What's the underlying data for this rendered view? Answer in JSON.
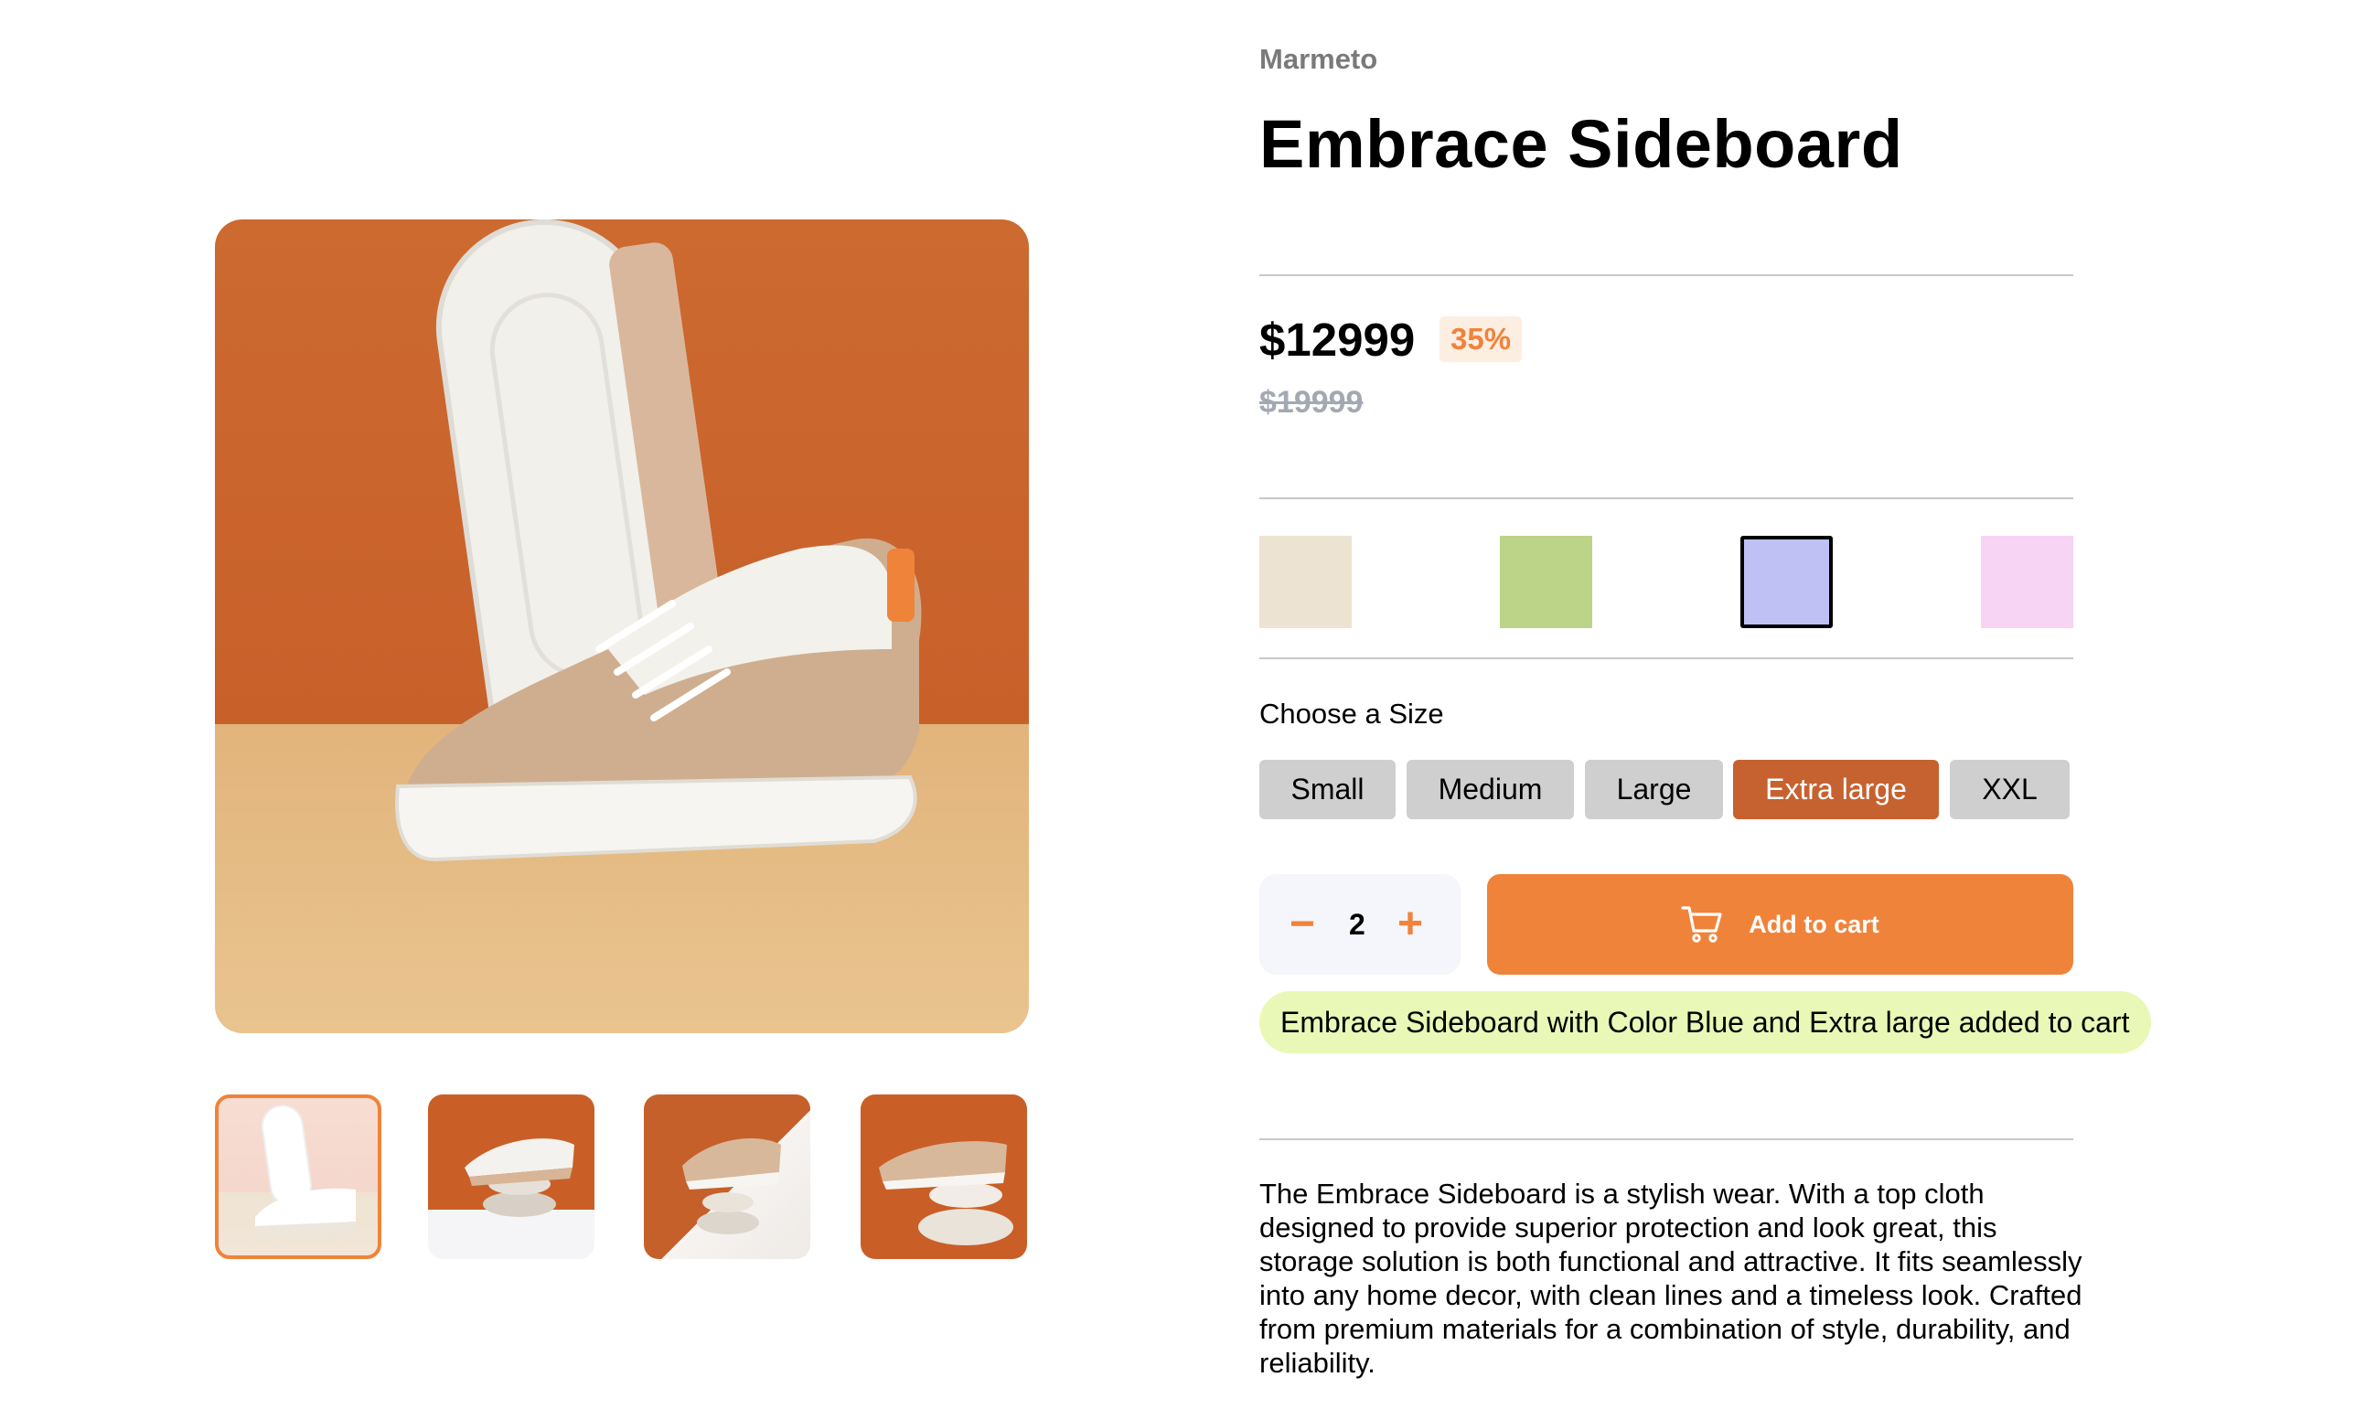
{
  "product": {
    "brand": "Marmeto",
    "title": "Embrace Sideboard",
    "price": "$12999",
    "discount": "35%",
    "original_price": "$19999",
    "description": "The Embrace Sideboard is a stylish wear. With a top cloth designed to provide superior protection and look great, this storage solution is both functional and attractive. It fits seamlessly into any home decor, with clean lines and a timeless look. Crafted from premium materials for a combination of style, durability, and reliability."
  },
  "gallery": {
    "main_image": "sneaker-product-photo",
    "thumbnails": [
      "sneaker-thumb-1",
      "sneaker-thumb-2",
      "sneaker-thumb-3",
      "sneaker-thumb-4"
    ],
    "active_thumbnail": 0
  },
  "colors": [
    {
      "hex": "#ece3d3",
      "selected": false
    },
    {
      "hex": "#bcd487",
      "selected": false
    },
    {
      "hex": "#bfc1f5",
      "selected": true
    },
    {
      "hex": "#f7d3f4",
      "selected": false
    }
  ],
  "size": {
    "heading": "Choose a Size",
    "options": [
      "Small",
      "Medium",
      "Large",
      "Extra large",
      "XXL"
    ],
    "selected": "Extra large"
  },
  "quantity": {
    "minus": "−",
    "value": "2",
    "plus": "+"
  },
  "cart": {
    "button_label": "Add to cart",
    "icon": "cart-icon",
    "message": "Embrace Sideboard with Color Blue and Extra large added to cart"
  },
  "theme": {
    "accent": "#f0833a",
    "size_active": "#c6622f",
    "toast_bg": "#e9f8b6"
  }
}
